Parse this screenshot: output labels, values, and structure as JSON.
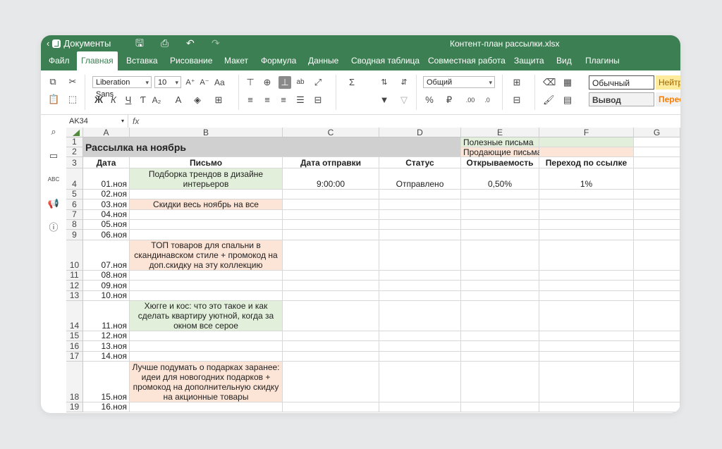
{
  "app": {
    "back_label": "Документы",
    "window_title": "Контент-план рассылки.xlsx"
  },
  "tabs": [
    "Файл",
    "Главная",
    "Вставка",
    "Рисование",
    "Макет",
    "Формула",
    "Данные",
    "Сводная таблица",
    "Совместная работа",
    "Защита",
    "Вид",
    "Плагины"
  ],
  "active_tab": "Главная",
  "toolbar": {
    "font_name": "Liberation Sans",
    "font_size": "10",
    "number_format": "Общий",
    "style_normal": "Обычный",
    "style_neutral": "Нейтр",
    "style_output": "Вывод",
    "style_calc": "Перес",
    "btn_increase_font": "A⁺",
    "btn_decrease_font": "A⁻",
    "btn_case": "Aa",
    "btn_bold": "Ж",
    "btn_italic": "К",
    "btn_underline": "Ч",
    "btn_strike": "Ƭ",
    "btn_subscript": "A₂",
    "btn_font_color": "A",
    "btn_percent": "%",
    "btn_sum": "Σ",
    "btn_inc_decimal": ".00",
    "btn_dec_decimal": ".0"
  },
  "formula_bar": {
    "name_box": "AK34",
    "fx_label": "fx",
    "value": ""
  },
  "columns": [
    "A",
    "B",
    "C",
    "D",
    "E",
    "F",
    "G"
  ],
  "sheet": {
    "title": "Рассылка на ноябрь",
    "legend_useful": "Полезные письма",
    "legend_selling": "Продающие письма",
    "headers": {
      "date": "Дата",
      "letter": "Письмо",
      "send_date": "Дата отправки",
      "status": "Статус",
      "open_rate": "Открываемость",
      "click_rate": "Переход по ссылке"
    },
    "rows": [
      {
        "num": "4",
        "date": "01.ноя",
        "letter": "Подборка трендов в дизайне интерьеров",
        "send": "9:00:00",
        "status": "Отправлено",
        "open": "0,50%",
        "click": "1%"
      },
      {
        "num": "5",
        "date": "02.ноя",
        "letter": "",
        "send": "",
        "status": "",
        "open": "",
        "click": ""
      },
      {
        "num": "6",
        "date": "03.ноя",
        "letter": "Скидки весь ноябрь на все",
        "send": "",
        "status": "",
        "open": "",
        "click": ""
      },
      {
        "num": "7",
        "date": "04.ноя",
        "letter": "",
        "send": "",
        "status": "",
        "open": "",
        "click": ""
      },
      {
        "num": "8",
        "date": "05.ноя",
        "letter": "",
        "send": "",
        "status": "",
        "open": "",
        "click": ""
      },
      {
        "num": "9",
        "date": "06.ноя",
        "letter": "",
        "send": "",
        "status": "",
        "open": "",
        "click": ""
      },
      {
        "num": "10",
        "date": "07.ноя",
        "letter": "ТОП товаров для спальни в скандинавском стиле + промокод на доп.скидку на эту коллекцию",
        "send": "",
        "status": "",
        "open": "",
        "click": ""
      },
      {
        "num": "11",
        "date": "08.ноя",
        "letter": "",
        "send": "",
        "status": "",
        "open": "",
        "click": ""
      },
      {
        "num": "12",
        "date": "09.ноя",
        "letter": "",
        "send": "",
        "status": "",
        "open": "",
        "click": ""
      },
      {
        "num": "13",
        "date": "10.ноя",
        "letter": "",
        "send": "",
        "status": "",
        "open": "",
        "click": ""
      },
      {
        "num": "14",
        "date": "11.ноя",
        "letter": "Хюгге и кос: что это такое и как сделать квартиру уютной, когда за окном все серое",
        "send": "",
        "status": "",
        "open": "",
        "click": ""
      },
      {
        "num": "15",
        "date": "12.ноя",
        "letter": "",
        "send": "",
        "status": "",
        "open": "",
        "click": ""
      },
      {
        "num": "16",
        "date": "13.ноя",
        "letter": "",
        "send": "",
        "status": "",
        "open": "",
        "click": ""
      },
      {
        "num": "17",
        "date": "14.ноя",
        "letter": "",
        "send": "",
        "status": "",
        "open": "",
        "click": ""
      },
      {
        "num": "18",
        "date": "15.ноя",
        "letter": "Лучше подумать о подарках заранее: идеи для новогодних подарков + промокод на дополнительную скидку на акционные товары",
        "send": "",
        "status": "",
        "open": "",
        "click": ""
      },
      {
        "num": "19",
        "date": "16.ноя",
        "letter": "",
        "send": "",
        "status": "",
        "open": "",
        "click": ""
      }
    ]
  },
  "colors": {
    "accent": "#3c7f53",
    "useful_fill": "#e2efda",
    "selling_fill": "#fce4d6",
    "title_fill": "#d0d0d0"
  }
}
